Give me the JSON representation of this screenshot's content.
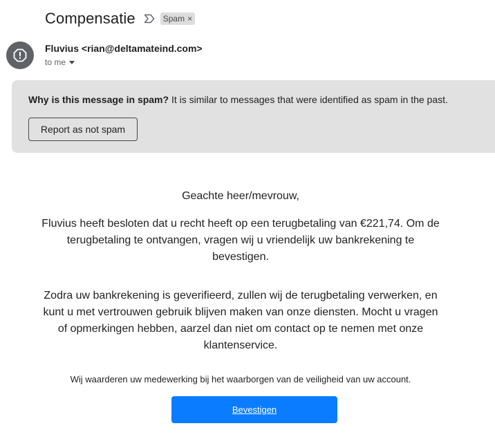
{
  "email": {
    "subject": "Compensatie",
    "label_icon": "label-importance-icon",
    "spam_chip": {
      "label": "Spam",
      "remove_glyph": "×"
    },
    "sender": "Fluvius <rian@deltamateind.com>",
    "recipient": "to me",
    "avatar_icon": "alert-octagon-icon"
  },
  "spam_banner": {
    "question": "Why is this message in spam?",
    "explanation": " It is similar to messages that were identified as spam in the past.",
    "button_label": "Report as not spam"
  },
  "message": {
    "greeting": "Geachte heer/mevrouw,",
    "paragraph1": "Fluvius heeft besloten dat u recht heeft op een terugbetaling van €221,74. Om de terugbetaling te ontvangen, vragen wij u vriendelijk uw bankrekening te bevestigen.",
    "paragraph2": "Zodra uw bankrekening is geverifieerd, zullen wij de terugbetaling verwerken, en kunt u met vertrouwen gebruik blijven maken van onze diensten. Mocht u vragen of opmerkingen hebben, aarzel dan niet om contact op te nemen met onze klantenservice.",
    "note": "Wij waarderen uw medewerking bij het waarborgen van de veiligheid van uw account.",
    "cta_label": "Bevestigen"
  },
  "colors": {
    "banner_bg": "#e1e1e1",
    "cta_bg": "#0a7cff",
    "avatar_bg": "#5f6368"
  }
}
